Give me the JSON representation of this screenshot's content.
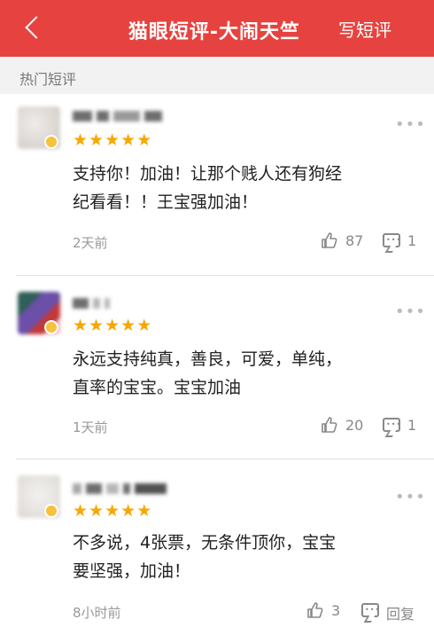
{
  "theme": {
    "brand": "#e64340",
    "star": "#f7a800"
  },
  "header": {
    "title": "猫眼短评-大闹天竺",
    "write_label": "写短评",
    "back_icon": "chevron-left-icon"
  },
  "section": {
    "label": "热门短评"
  },
  "comments": [
    {
      "rating": 5,
      "text_line1": "支持你！加油！让那个贱人还有狗经",
      "text_line2": "纪看看！！王宝强加油！",
      "time": "2天前",
      "likes": "87",
      "replies": "1",
      "avatar_color": "#d9d4d0"
    },
    {
      "rating": 5,
      "text_line1": "永远支持纯真，善良，可爱，单纯，",
      "text_line2": "直率的宝宝。宝宝加油",
      "time": "1天前",
      "likes": "20",
      "replies": "1",
      "avatar_color": "#6b4fa8"
    },
    {
      "rating": 5,
      "text_line1": "不多说，4张票，无条件顶你，宝宝",
      "text_line2": "要坚强，加油！",
      "time": "8小时前",
      "likes": "3",
      "replies": "回复",
      "avatar_color": "#e6e3e0"
    }
  ],
  "icons": {
    "more": "more-dots-icon",
    "like": "thumb-up-icon",
    "reply": "comment-bubble-icon",
    "star": "star-icon"
  }
}
